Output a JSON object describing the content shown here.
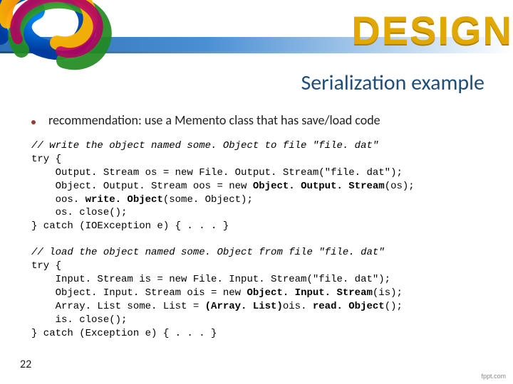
{
  "header": {
    "brand_word": "DESIGN"
  },
  "slide": {
    "title": "Serialization example",
    "bullet": "recommendation: use a Memento class that has save/load code",
    "page_number": "22",
    "footer_brand": "fppt.com"
  },
  "code1": {
    "comment": "// write the object named some. Object to file \"file. dat\"",
    "l1": "try {",
    "l2": "    Output. Stream os = new File. Output. Stream(\"file. dat\");",
    "l3a": "    Object. Output. Stream oos = new ",
    "l3b": "Object. Output. Stream",
    "l3c": "(os);",
    "l4a": "    oos. ",
    "l4b": "write. Object",
    "l4c": "(some. Object);",
    "l5": "    os. close();",
    "l6": "} catch (IOException e) { . . . }"
  },
  "code2": {
    "comment": "// load the object named some. Object from file \"file. dat\"",
    "l1": "try {",
    "l2": "    Input. Stream is = new File. Input. Stream(\"file. dat\");",
    "l3a": "    Object. Input. Stream ois = new ",
    "l3b": "Object. Input. Stream",
    "l3c": "(is);",
    "l4a": "    Array. List some. List = ",
    "l4b": "(Array. List)",
    "l4c": "ois. ",
    "l4d": "read. Object",
    "l4e": "();",
    "l5": "    is. close();",
    "l6": "} catch (Exception e) { . . . }"
  }
}
